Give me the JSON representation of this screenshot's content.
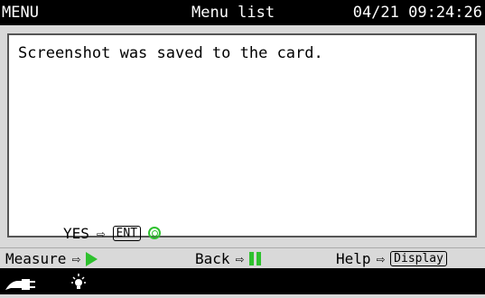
{
  "header": {
    "mode": "MENU",
    "title": "Menu list",
    "datetime": "04/21 09:24:26"
  },
  "dialog": {
    "message": "Screenshot was saved to the card.",
    "yes_label": "YES",
    "yes_key": "ENT"
  },
  "statusbar": {
    "measure_label": "Measure",
    "back_label": "Back",
    "help_label": "Help",
    "help_key": "Display"
  },
  "icons": {
    "arrow": "right-arrow-icon",
    "enter_confirm": "green-circle-icon",
    "measure": "green-play-icon",
    "back": "green-pause-icon",
    "power": "ac-plug-icon",
    "backlight": "light-bulb-icon"
  },
  "colors": {
    "accent_green": "#2ec12e",
    "bar_black": "#000000",
    "panel_gray": "#d9d9d9"
  }
}
